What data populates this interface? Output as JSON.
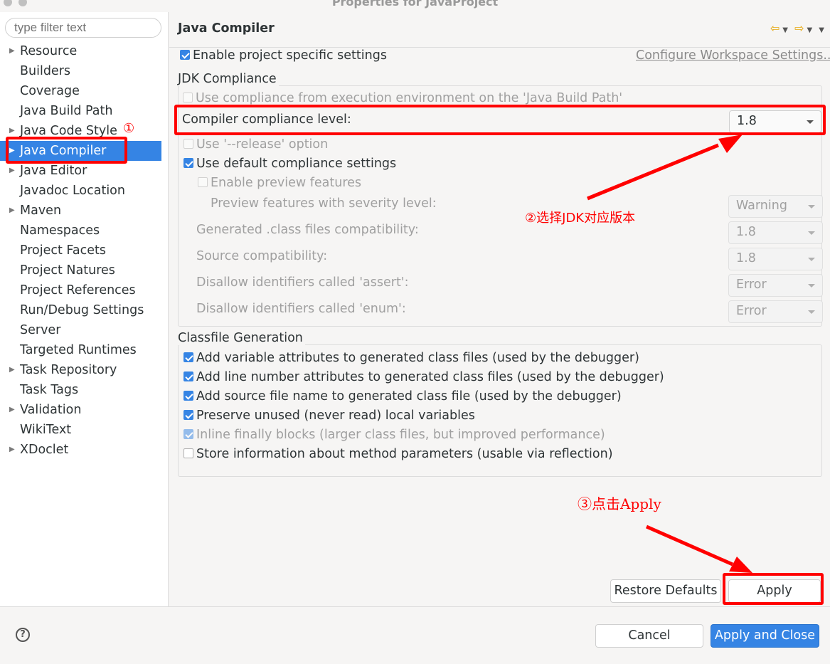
{
  "window": {
    "title": "Properties for JavaProject"
  },
  "sidebar": {
    "filter_placeholder": "type filter text",
    "items": [
      {
        "label": "Resource",
        "expandable": true
      },
      {
        "label": "Builders",
        "expandable": false
      },
      {
        "label": "Coverage",
        "expandable": false
      },
      {
        "label": "Java Build Path",
        "expandable": false
      },
      {
        "label": "Java Code Style",
        "expandable": true
      },
      {
        "label": "Java Compiler",
        "expandable": true,
        "selected": true
      },
      {
        "label": "Java Editor",
        "expandable": true
      },
      {
        "label": "Javadoc Location",
        "expandable": false
      },
      {
        "label": "Maven",
        "expandable": true
      },
      {
        "label": "Namespaces",
        "expandable": false
      },
      {
        "label": "Project Facets",
        "expandable": false
      },
      {
        "label": "Project Natures",
        "expandable": false
      },
      {
        "label": "Project References",
        "expandable": false
      },
      {
        "label": "Run/Debug Settings",
        "expandable": false
      },
      {
        "label": "Server",
        "expandable": false
      },
      {
        "label": "Targeted Runtimes",
        "expandable": false
      },
      {
        "label": "Task Repository",
        "expandable": true
      },
      {
        "label": "Task Tags",
        "expandable": false
      },
      {
        "label": "Validation",
        "expandable": true
      },
      {
        "label": "WikiText",
        "expandable": false
      },
      {
        "label": "XDoclet",
        "expandable": true
      }
    ]
  },
  "page": {
    "title": "Java Compiler",
    "enable_specific": "Enable project specific settings",
    "configure_link": "Configure Workspace Settings...",
    "jdk_group": "JDK Compliance",
    "use_compliance_env": "Use compliance from execution environment on the 'Java Build Path'",
    "compliance_level_label": "Compiler compliance level:",
    "compliance_level_value": "1.8",
    "release_option": "Use '--release' option",
    "use_default": "Use default compliance settings",
    "enable_preview": "Enable preview features",
    "preview_severity_label": "Preview features with severity level:",
    "preview_severity_value": "Warning",
    "generated_class_label": "Generated .class files compatibility:",
    "generated_class_value": "1.8",
    "source_compat_label": "Source compatibility:",
    "source_compat_value": "1.8",
    "assert_label": "Disallow identifiers called 'assert':",
    "assert_value": "Error",
    "enum_label": "Disallow identifiers called 'enum':",
    "enum_value": "Error",
    "classfile_group": "Classfile Generation",
    "cf_variable": "Add variable attributes to generated class files (used by the debugger)",
    "cf_line": "Add line number attributes to generated class files (used by the debugger)",
    "cf_source": "Add source file name to generated class file (used by the debugger)",
    "cf_preserve": "Preserve unused (never read) local variables",
    "cf_inline": "Inline finally blocks (larger class files, but improved performance)",
    "cf_store": "Store information about method parameters (usable via reflection)",
    "restore_defaults": "Restore Defaults",
    "apply": "Apply"
  },
  "footer": {
    "help": "?",
    "cancel": "Cancel",
    "apply_close": "Apply and Close"
  },
  "annotations": {
    "step1": "①",
    "step2": "②选择JDK对应版本",
    "step3": "③点击Apply",
    "color": "#ff0000"
  },
  "colors": {
    "accent": "#3584e4",
    "annotation": "#ff0000"
  }
}
